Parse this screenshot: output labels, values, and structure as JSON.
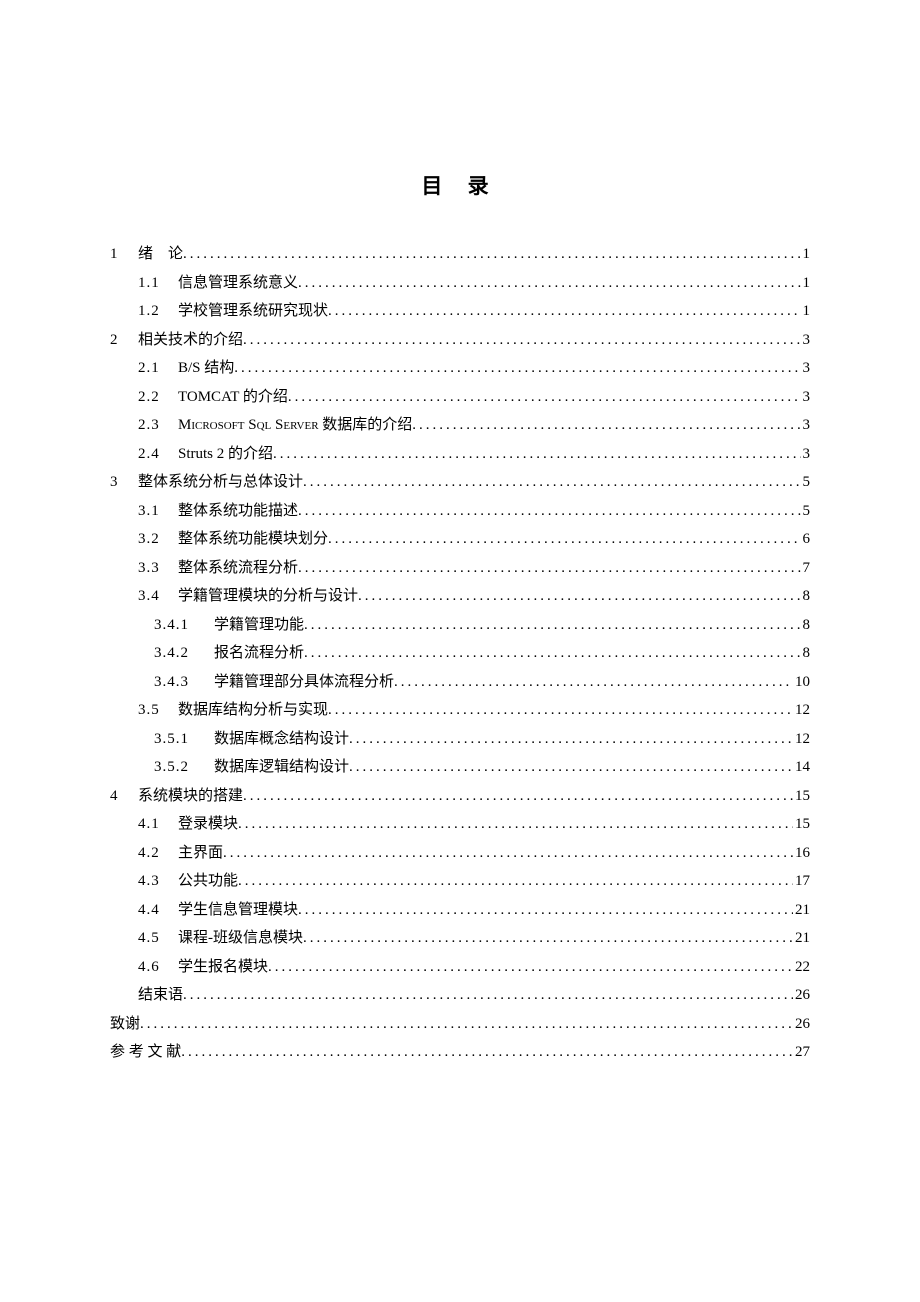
{
  "title": "目 录",
  "entries": [
    {
      "indent": 0,
      "num": "1",
      "numClass": "num-l1",
      "label": "绪　论",
      "page": "1"
    },
    {
      "indent": 1,
      "num": "1.1",
      "numClass": "num-l2",
      "label": "信息管理系统意义",
      "page": "1"
    },
    {
      "indent": 1,
      "num": "1.2",
      "numClass": "num-l2",
      "label": "学校管理系统研究现状",
      "page": "1"
    },
    {
      "indent": 0,
      "num": "2",
      "numClass": "num-l1",
      "label": "相关技术的介绍",
      "page": "3"
    },
    {
      "indent": 1,
      "num": "2.1",
      "numClass": "num-l2",
      "label": "B/S 结构",
      "page": "3"
    },
    {
      "indent": 1,
      "num": "2.2",
      "numClass": "num-l2",
      "label": "TOMCAT 的介绍",
      "page": "3"
    },
    {
      "indent": 1,
      "num": "2.3",
      "numClass": "num-l2",
      "label": "Microsoft Sql Server 数据库的介绍",
      "page": "3",
      "labelClass": "smallcaps"
    },
    {
      "indent": 1,
      "num": "2.4",
      "numClass": "num-l2",
      "label": " Struts 2 的介绍",
      "page": "3"
    },
    {
      "indent": 0,
      "num": "3",
      "numClass": "num-l1",
      "label": "整体系统分析与总体设计",
      "page": "5"
    },
    {
      "indent": 1,
      "num": "3.1",
      "numClass": "num-l2",
      "label": "整体系统功能描述",
      "page": "5"
    },
    {
      "indent": 1,
      "num": "3.2",
      "numClass": "num-l2",
      "label": "整体系统功能模块划分",
      "page": "6"
    },
    {
      "indent": 1,
      "num": "3.3",
      "numClass": "num-l2",
      "label": "整体系统流程分析",
      "page": "7"
    },
    {
      "indent": 1,
      "num": "3.4",
      "numClass": "num-l2",
      "label": "学籍管理模块的分析与设计",
      "page": "8"
    },
    {
      "indent": 2,
      "num": "3.4.1",
      "numClass": "num-l3",
      "label": "学籍管理功能",
      "page": "8"
    },
    {
      "indent": 2,
      "num": "3.4.2",
      "numClass": "num-l3",
      "label": "报名流程分析",
      "page": "8"
    },
    {
      "indent": 2,
      "num": "3.4.3",
      "numClass": "num-l3",
      "label": "学籍管理部分具体流程分析",
      "page": "10"
    },
    {
      "indent": 1,
      "num": "3.5",
      "numClass": "num-l2",
      "label": "数据库结构分析与实现",
      "page": "12"
    },
    {
      "indent": 2,
      "num": "3.5.1",
      "numClass": "num-l3",
      "label": "数据库概念结构设计",
      "page": "12"
    },
    {
      "indent": 2,
      "num": "3.5.2",
      "numClass": "num-l3",
      "label": "数据库逻辑结构设计",
      "page": "14"
    },
    {
      "indent": 0,
      "num": "4",
      "numClass": "num-l1",
      "label": "系统模块的搭建",
      "page": "15"
    },
    {
      "indent": 1,
      "num": "4.1",
      "numClass": "num-l2",
      "label": "登录模块",
      "page": "15"
    },
    {
      "indent": 1,
      "num": "4.2",
      "numClass": "num-l2",
      "label": "主界面",
      "page": "16"
    },
    {
      "indent": 1,
      "num": "4.3",
      "numClass": "num-l2",
      "label": "公共功能",
      "page": "17"
    },
    {
      "indent": 1,
      "num": "4.4",
      "numClass": "num-l2",
      "label": "学生信息管理模块",
      "page": "21"
    },
    {
      "indent": 1,
      "num": "4.5",
      "numClass": "num-l2",
      "label": "课程-班级信息模块",
      "page": "21"
    },
    {
      "indent": 1,
      "num": "4.6",
      "numClass": "num-l2",
      "label": "学生报名模块",
      "page": "22"
    },
    {
      "indent": 1,
      "num": "",
      "numClass": "",
      "label": "结束语",
      "page": "26"
    },
    {
      "indent": 0,
      "num": "",
      "numClass": "",
      "label": "致谢",
      "page": "26"
    },
    {
      "indent": 0,
      "num": "",
      "numClass": "",
      "label": "参 考 文 献",
      "page": "27"
    }
  ]
}
